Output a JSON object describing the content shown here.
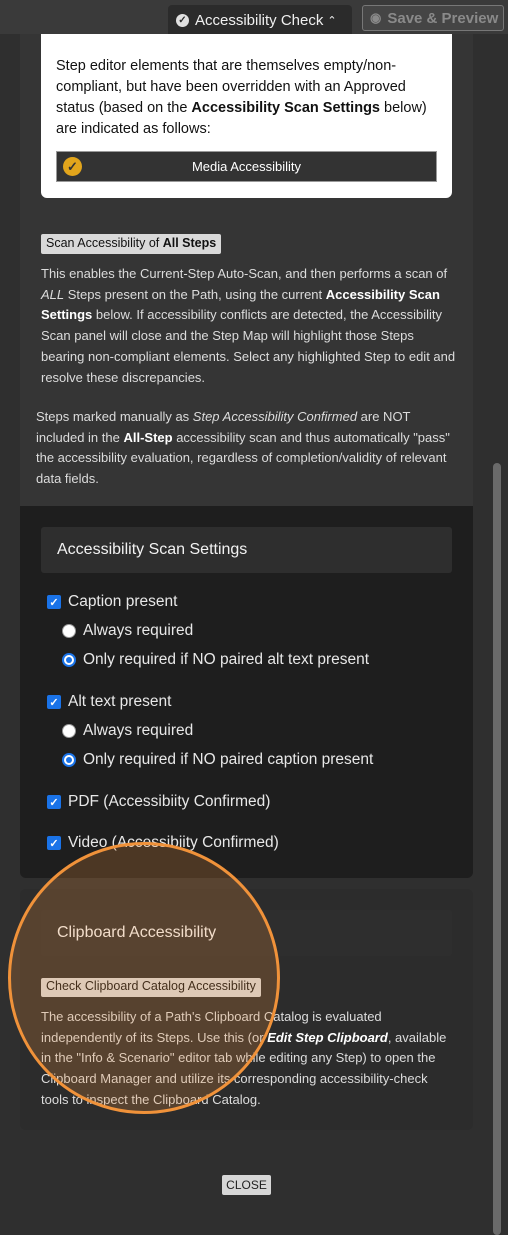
{
  "tabs": {
    "active_label": "Accessibility Check",
    "preview_label": "Save & Preview"
  },
  "legend": {
    "text_1": "Step editor elements that are themselves empty/non-compliant, but have been overridden with an Approved status (based on the ",
    "text_bold": "Accessibility Scan Settings",
    "text_2": " below) are indicated as follows:",
    "media_label": "Media Accessibility",
    "media_color": "#e2a51c"
  },
  "scan_all": {
    "button_prefix": "Scan Accessibility of ",
    "button_bold": "All Steps",
    "p1_a": "This enables the Current-Step Auto-Scan, and then performs a scan of ",
    "p1_italic": "ALL",
    "p1_b": " Steps present on the Path, using the current ",
    "p1_bold": "Accessibility Scan Settings",
    "p1_c": " below. If accessibility conflicts are detected, the Accessibility Scan panel will close and the Step Map will highlight those Steps bearing non-compliant elements. Select any highlighted Step to edit and resolve these discrepancies.",
    "p2_a": "Steps marked manually as ",
    "p2_italic": "Step Accessibility Confirmed",
    "p2_b": " are NOT included in the ",
    "p2_bold": "All-Step",
    "p2_c": " accessibility scan and thus automatically \"pass\" the accessibility evaluation, regardless of completion/validity of relevant data fields."
  },
  "settings": {
    "title": "Accessibility Scan Settings",
    "caption_present": "Caption present",
    "caption_always": "Always required",
    "caption_only_if": "Only required if NO paired alt text present",
    "alt_present": "Alt text present",
    "alt_always": "Always required",
    "alt_only_if": "Only required if NO paired caption present",
    "pdf": "PDF (Accessibiity Confirmed)",
    "video": "Video (Accessibiity Confirmed)"
  },
  "clipboard": {
    "title": "Clipboard Accessibility",
    "button": "Check Clipboard Catalog Accessibility",
    "p_a": "The accessibility of a Path's Clipboard Catalog is evaluated independently of its Steps. Use this (or ",
    "p_bold": "Edit Step Clipboard",
    "p_b": ", available in the \"Info & Scenario\" editor tab while editing any Step) to open the Clipboard Manager and utilize its corresponding accessibility-check tools to inspect the Clipboard Catalog."
  },
  "close_label": "CLOSE",
  "colors": {
    "accent_blue": "#1a73e8",
    "highlight_orange": "#f0923a"
  }
}
